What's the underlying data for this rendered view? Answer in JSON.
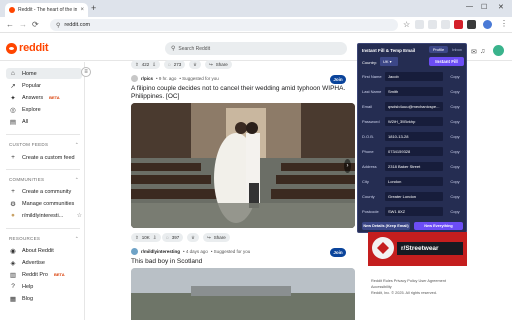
{
  "browser": {
    "tab_title": "Reddit - The heart of the intern",
    "tab_close": "×",
    "new_tab": "+",
    "url": "reddit.com",
    "win_min": "—",
    "win_max": "☐",
    "win_close": "✕",
    "nav_back": "←",
    "nav_forward": "→",
    "nav_reload": "⟳",
    "menu": "⋮",
    "star": "☆"
  },
  "header": {
    "logo": "reddit",
    "search_placeholder": "Search Reddit"
  },
  "sidebar": {
    "items_top": [
      {
        "icon": "⌂",
        "label": "Home"
      },
      {
        "icon": "↗",
        "label": "Popular"
      },
      {
        "icon": "✦",
        "label": "Answers",
        "badge": "BETA"
      },
      {
        "icon": "◎",
        "label": "Explore"
      },
      {
        "icon": "▤",
        "label": "All"
      }
    ],
    "custom_feeds": {
      "heading": "CUSTOM FEEDS",
      "chev": "⌃",
      "item": {
        "icon": "+",
        "label": "Create a custom feed"
      }
    },
    "communities": {
      "heading": "COMMUNITIES",
      "chev": "⌃",
      "items": [
        {
          "icon": "+",
          "label": "Create a community"
        },
        {
          "icon": "⚙",
          "label": "Manage communities"
        },
        {
          "icon": "●",
          "label": "r/mildlyinteresti..."
        }
      ]
    },
    "resources": {
      "heading": "RESOURCES",
      "chev": "⌃",
      "items": [
        {
          "icon": "◉",
          "label": "About Reddit"
        },
        {
          "icon": "◈",
          "label": "Advertise"
        },
        {
          "icon": "▥",
          "label": "Reddit Pro",
          "badge": "BETA"
        },
        {
          "icon": "?",
          "label": "Help"
        },
        {
          "icon": "▦",
          "label": "Blog"
        }
      ]
    },
    "collapse_icon": "≡"
  },
  "feed": {
    "post1": {
      "subreddit": "r/pics",
      "age": "• 9 hr. ago",
      "suggested": "• Suggested for you",
      "join": "Join",
      "title": "A filipino couple decides not to cancel their wedding amid typhoon WIPHA. Philippines. [OC]",
      "top_votes": "422",
      "top_comments": "273",
      "top_share": "Share",
      "votes": "10K",
      "comments": "397",
      "share": "Share"
    },
    "post2": {
      "subreddit": "r/mildlyinteresting",
      "age": "• 4 days ago",
      "suggested": "• Suggested for you",
      "join": "Join",
      "title": "This bad boy in Scotland"
    }
  },
  "popup": {
    "title": "Instant Fill & Temp Email",
    "tab_profile": "Profile",
    "tab_inbox": "Inbox",
    "country_label": "Country:",
    "country_value": "UK ▾",
    "instant_fill": "Instant Fill",
    "rows": [
      {
        "label": "First Name",
        "value": "Jacob"
      },
      {
        "label": "Last Name",
        "value": "Smith"
      },
      {
        "label": "Email",
        "value": "qwdsb4uuu@mechanicspe..."
      },
      {
        "label": "Password",
        "value": "W2iH_3!lBvkhp"
      },
      {
        "label": "D.O.B.",
        "value": "1810-13-28"
      },
      {
        "label": "Phone",
        "value": "0734159328"
      },
      {
        "label": "Address",
        "value": "2318 Baker Street"
      },
      {
        "label": "City",
        "value": "London"
      },
      {
        "label": "County",
        "value": "Greater London"
      },
      {
        "label": "Postcode",
        "value": "SW1 8XZ"
      }
    ],
    "copy": "Copy",
    "new_details": "New Details (Keep Email)",
    "new_everything": "New Everything"
  },
  "right": {
    "banner_text": "r/Streetwear",
    "footer_lines": [
      "Reddit Rules  Privacy Policy  User Agreement",
      "Accessibility",
      "Reddit, Inc. © 2025. All rights reserved."
    ]
  },
  "colors": {
    "reddit_orange": "#ff4500",
    "join_blue": "#0a449b",
    "popup_bg": "#252d52",
    "instant_fill_purple": "#6c4df5"
  }
}
